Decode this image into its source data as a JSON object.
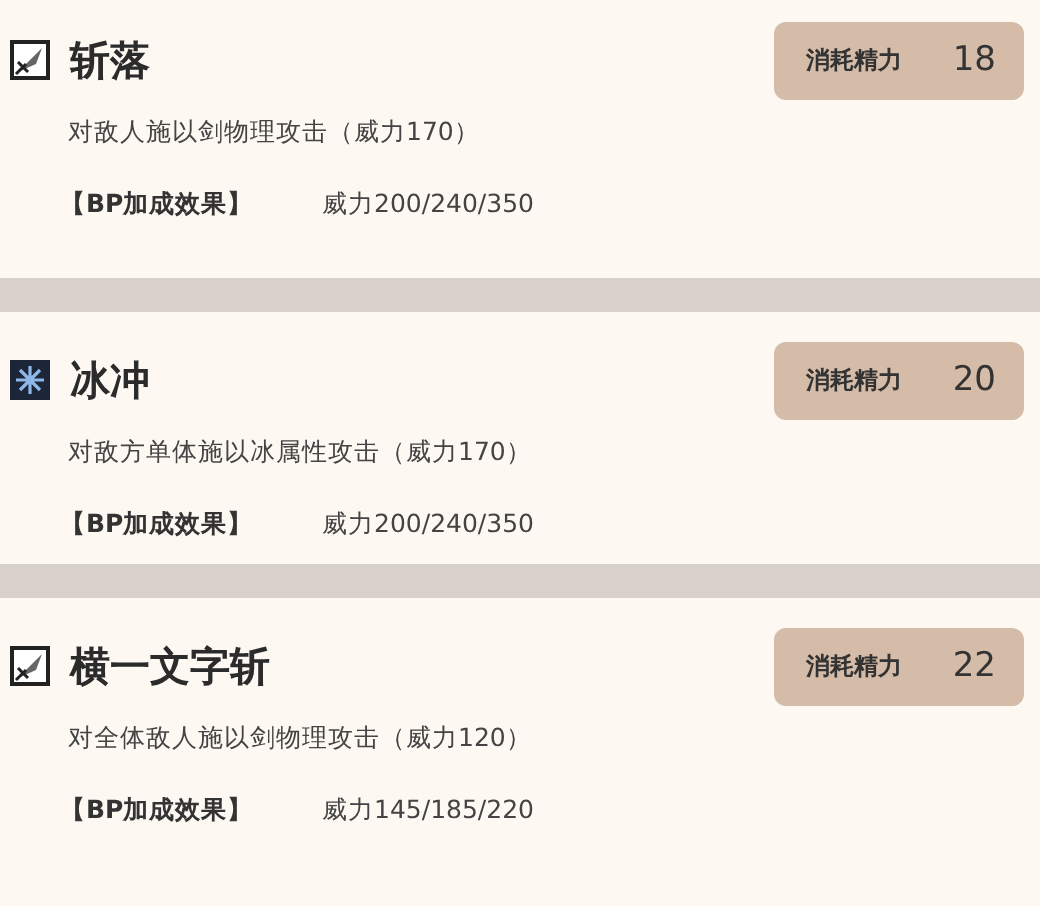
{
  "skills": [
    {
      "icon": {
        "kind": "sword"
      },
      "name": "斩落",
      "cost_label": "消耗精力",
      "cost": "18",
      "description": "对敌人施以剑物理攻击（威力170）",
      "bp_label": "【BP加成效果】",
      "bp_value": "威力200/240/350"
    },
    {
      "icon": {
        "kind": "ice"
      },
      "name": "冰冲",
      "cost_label": "消耗精力",
      "cost": "20",
      "description": "对敌方单体施以冰属性攻击（威力170）",
      "bp_label": "【BP加成效果】",
      "bp_value": "威力200/240/350"
    },
    {
      "icon": {
        "kind": "sword"
      },
      "name": "横一文字斩",
      "cost_label": "消耗精力",
      "cost": "22",
      "description": "对全体敌人施以剑物理攻击（威力120）",
      "bp_label": "【BP加成效果】",
      "bp_value": "威力145/185/220"
    }
  ]
}
